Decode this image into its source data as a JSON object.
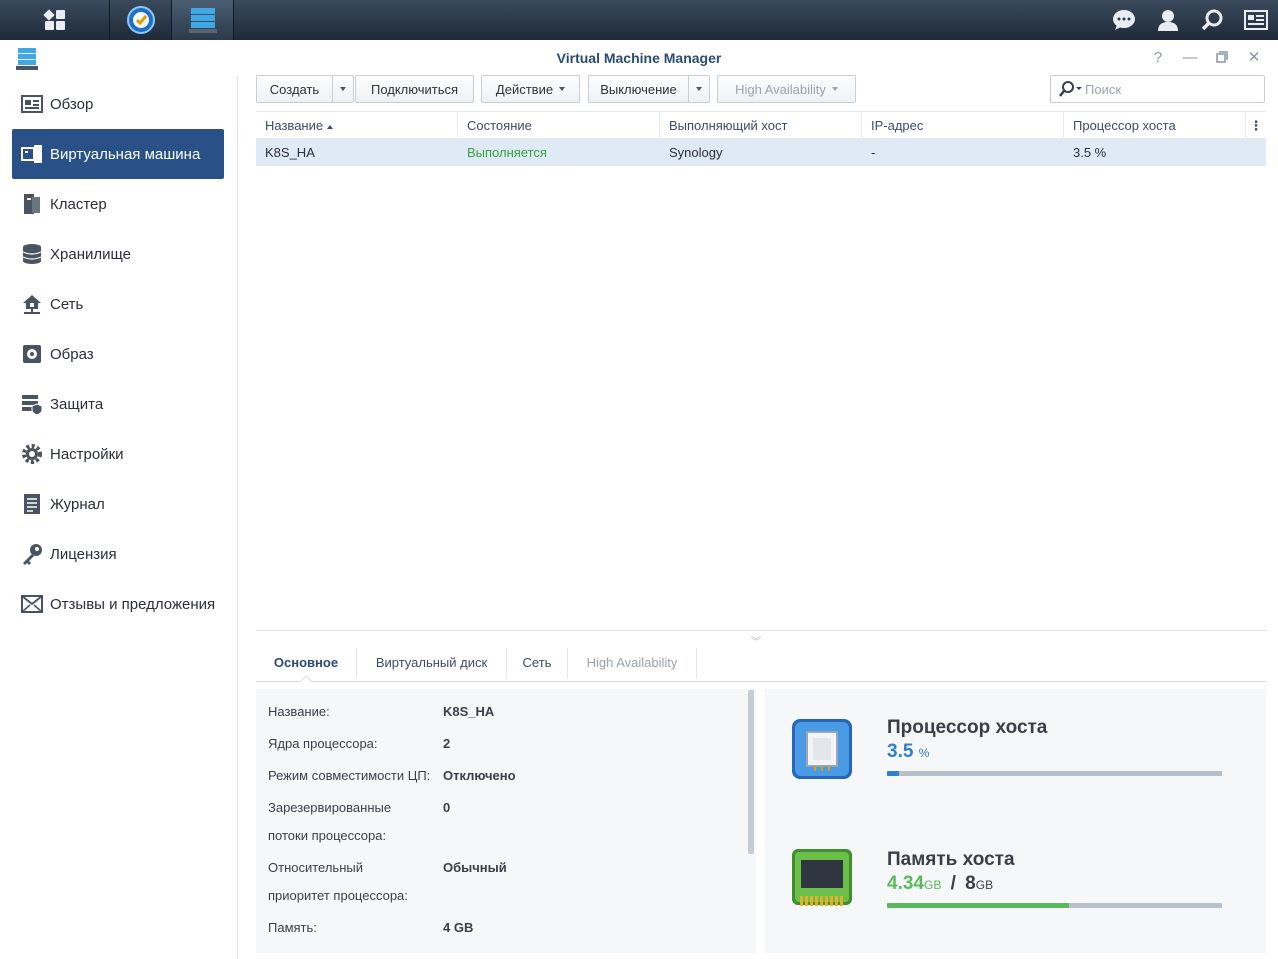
{
  "window": {
    "title": "Virtual Machine Manager"
  },
  "taskbar": {
    "icons": [
      "main-menu-icon",
      "app-update-icon",
      "vmm-app-icon",
      "notifications-icon",
      "user-icon",
      "search-icon",
      "widgets-icon"
    ]
  },
  "sidebar": {
    "items": [
      {
        "label": "Обзор",
        "icon": "overview-icon"
      },
      {
        "label": "Виртуальная машина",
        "icon": "virtual-machine-icon",
        "selected": true
      },
      {
        "label": "Кластер",
        "icon": "cluster-icon"
      },
      {
        "label": "Хранилище",
        "icon": "storage-icon"
      },
      {
        "label": "Сеть",
        "icon": "network-icon"
      },
      {
        "label": "Образ",
        "icon": "image-icon"
      },
      {
        "label": "Защита",
        "icon": "protection-icon"
      },
      {
        "label": "Настройки",
        "icon": "settings-icon"
      },
      {
        "label": "Журнал",
        "icon": "log-icon"
      },
      {
        "label": "Лицензия",
        "icon": "license-icon"
      },
      {
        "label": "Отзывы и предложения",
        "icon": "feedback-icon"
      }
    ]
  },
  "toolbar": {
    "create": "Создать",
    "connect": "Подключиться",
    "action": "Действие",
    "shutdown": "Выключение",
    "high_availability": "High Availability"
  },
  "search": {
    "placeholder": "Поиск"
  },
  "grid": {
    "columns": [
      "Название",
      "Состояние",
      "Выполняющий хост",
      "IP-адрес",
      "Процессор хоста"
    ],
    "rows": [
      {
        "name": "K8S_HA",
        "status": "Выполняется",
        "host": "Synology",
        "ip": "-",
        "cpu": "3.5 %"
      }
    ]
  },
  "tabs": [
    "Основное",
    "Виртуальный диск",
    "Сеть",
    "High Availability"
  ],
  "details": {
    "name_label": "Название:",
    "name_value": "K8S_HA",
    "cores_label": "Ядра процессора:",
    "cores_value": "2",
    "compat_label": "Режим совместимости ЦП:",
    "compat_value": "Отключено",
    "reserved_label_1": "Зарезервированные",
    "reserved_label_2": "потоки процессора:",
    "reserved_value": "0",
    "priority_label_1": "Относительный",
    "priority_label_2": "приоритет процессора:",
    "priority_value": "Обычный",
    "memory_label": "Память:",
    "memory_value": "4 GB"
  },
  "monitor": {
    "cpu": {
      "title": "Процессор хоста",
      "value": "3.5",
      "unit": "%",
      "percent": 3.5,
      "color": "#2f7fd1"
    },
    "memory": {
      "title": "Память хоста",
      "used": "4.34",
      "used_unit": "GB",
      "separator": "/",
      "total": "8",
      "total_unit": "GB",
      "percent": 54.25,
      "color": "#5cb85c"
    }
  },
  "colors": {
    "accent": "#2a5187",
    "running": "#3aa33a",
    "row_selected": "#dfeaf7"
  }
}
